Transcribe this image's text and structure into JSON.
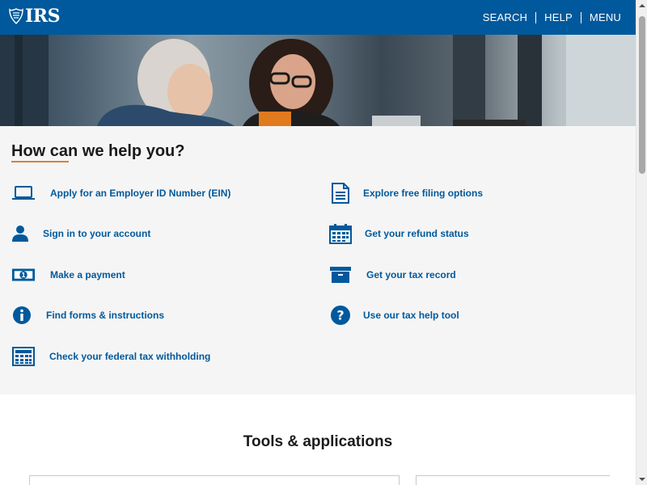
{
  "header": {
    "logo_text": "IRS",
    "nav": [
      {
        "label": "SEARCH"
      },
      {
        "label": "HELP"
      },
      {
        "label": "MENU"
      }
    ]
  },
  "help": {
    "title": "How can we help you?",
    "links": [
      {
        "label": "Apply for an Employer ID Number (EIN)",
        "icon": "laptop-icon"
      },
      {
        "label": "Explore free filing options",
        "icon": "document-icon"
      },
      {
        "label": "Sign in to your account",
        "icon": "user-icon"
      },
      {
        "label": "Get your refund status",
        "icon": "calendar-icon"
      },
      {
        "label": "Make a payment",
        "icon": "money-icon"
      },
      {
        "label": "Get your tax record",
        "icon": "archive-box-icon"
      },
      {
        "label": "Find forms & instructions",
        "icon": "info-icon"
      },
      {
        "label": "Use our tax help tool",
        "icon": "question-icon"
      },
      {
        "label": "Check your federal tax withholding",
        "icon": "calculator-icon"
      }
    ]
  },
  "tools": {
    "title": "Tools & applications"
  },
  "colors": {
    "brand_blue": "#00599c",
    "accent_orange": "#d5833a",
    "panel_bg": "#f5f5f5"
  }
}
